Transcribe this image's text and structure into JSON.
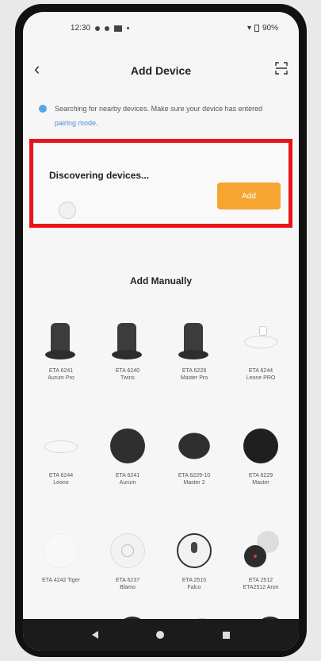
{
  "status_bar": {
    "time": "12:30",
    "battery": "90%"
  },
  "header": {
    "title": "Add Device",
    "back_icon": "chevron-left-icon",
    "scan_icon": "scan-icon"
  },
  "hint": {
    "text": "Searching for nearby devices. Make sure your device has entered",
    "link": "pairing mode",
    "suffix": "."
  },
  "discover": {
    "title": "Discovering devices...",
    "add_label": "Add",
    "highlight_color": "#e8141b",
    "button_color": "#f7a531"
  },
  "manual": {
    "title": "Add Manually",
    "devices": [
      {
        "name": "ETA 6241\nAurum Pro",
        "icon": "tower-dark"
      },
      {
        "name": "ETA 6240\nTwins",
        "icon": "tower-dark"
      },
      {
        "name": "ETA 6229\nMaster Pro",
        "icon": "tower-dark"
      },
      {
        "name": "ETA 6244\nLeone PRO",
        "icon": "robot-white"
      },
      {
        "name": "ETA 6244\nLeone",
        "icon": "robot-white"
      },
      {
        "name": "ETA 6241\nAurum",
        "icon": "robot-dark"
      },
      {
        "name": "ETA 6229-10\nMaster 2",
        "icon": "robot-dark"
      },
      {
        "name": "ETA 6229\nMaster",
        "icon": "robot-dark"
      },
      {
        "name": "ETA 4242 Tiger",
        "icon": "robot-white"
      },
      {
        "name": "ETA 6237\nBlamo",
        "icon": "robot-light"
      },
      {
        "name": "ETA 2515\nFalco",
        "icon": "robot-light"
      },
      {
        "name": "ETA 2512\nETA2512 Aron",
        "icon": "robot-dark"
      }
    ]
  }
}
